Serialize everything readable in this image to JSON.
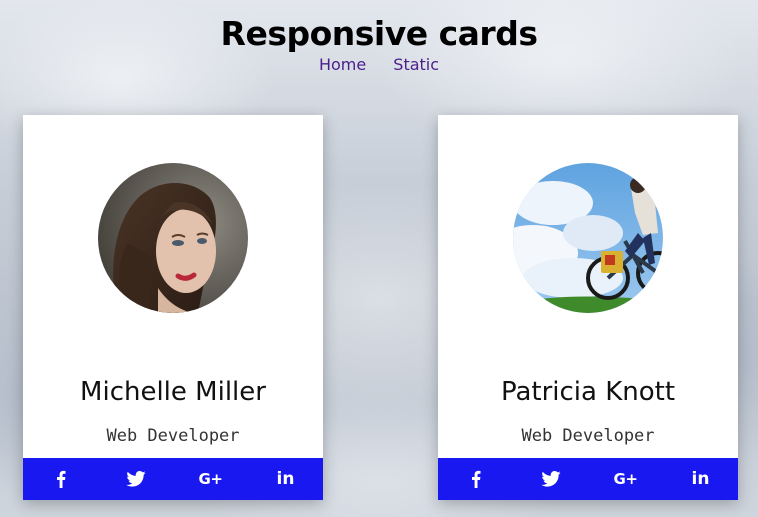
{
  "page": {
    "title": "Responsive cards"
  },
  "nav": {
    "items": [
      {
        "label": "Home"
      },
      {
        "label": "Static"
      }
    ]
  },
  "cards": [
    {
      "name": "Michelle Miller",
      "role": "Web Developer",
      "avatar": "portrait-photo"
    },
    {
      "name": "Patricia Knott",
      "role": "Web Developer",
      "avatar": "bicycle-photo"
    }
  ],
  "social": {
    "icons": [
      "facebook-icon",
      "twitter-icon",
      "google-plus-icon",
      "linkedin-icon"
    ],
    "gplus_label": "G+",
    "linkedin_label": "in"
  },
  "colors": {
    "social_bar": "#1a18f0",
    "nav_link": "#4b1e8a",
    "card_bg": "#ffffff"
  }
}
